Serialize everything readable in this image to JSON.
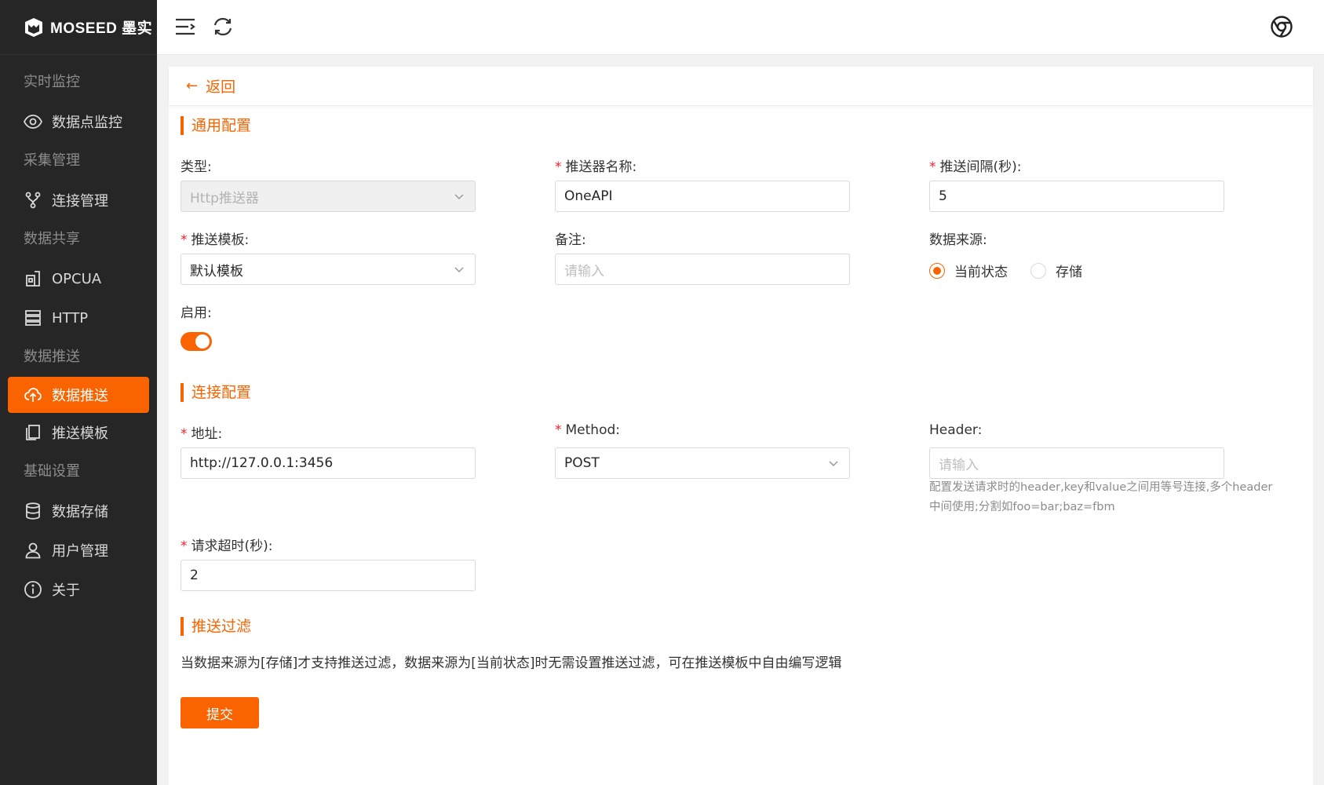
{
  "brand": {
    "name": "MOSEED 墨实"
  },
  "sidebar": {
    "groups": [
      {
        "title": "实时监控",
        "items": [
          {
            "label": "数据点监控",
            "icon": "eye-icon"
          }
        ]
      },
      {
        "title": "采集管理",
        "items": [
          {
            "label": "连接管理",
            "icon": "branch-icon"
          }
        ]
      },
      {
        "title": "数据共享",
        "items": [
          {
            "label": "OPCUA",
            "icon": "building-icon"
          },
          {
            "label": "HTTP",
            "icon": "server-icon"
          }
        ]
      },
      {
        "title": "数据推送",
        "items": [
          {
            "label": "数据推送",
            "icon": "cloud-upload-icon",
            "active": true
          },
          {
            "label": "推送模板",
            "icon": "copy-icon"
          }
        ]
      },
      {
        "title": "基础设置",
        "items": [
          {
            "label": "数据存储",
            "icon": "database-icon"
          },
          {
            "label": "用户管理",
            "icon": "user-icon"
          },
          {
            "label": "关于",
            "icon": "info-icon"
          }
        ]
      }
    ]
  },
  "topbar": {
    "icons": [
      "menu-fold-icon",
      "refresh-icon",
      "chrome-icon"
    ]
  },
  "page": {
    "back_label": "返回"
  },
  "form": {
    "section_general": "通用配置",
    "type": {
      "label": "类型:",
      "value": "Http推送器"
    },
    "name": {
      "label": "推送器名称:",
      "value": "OneAPI"
    },
    "interval": {
      "label": "推送间隔(秒):",
      "value": "5"
    },
    "template": {
      "label": "推送模板:",
      "value": "默认模板"
    },
    "remark": {
      "label": "备注:",
      "placeholder": "请输入"
    },
    "source": {
      "label": "数据来源:",
      "options": [
        "当前状态",
        "存储"
      ],
      "selected": "当前状态"
    },
    "enabled": {
      "label": "启用:",
      "value": true
    },
    "section_connection": "连接配置",
    "address": {
      "label": "地址:",
      "value": "http://127.0.0.1:3456"
    },
    "method": {
      "label": "Method:",
      "value": "POST"
    },
    "header": {
      "label": "Header:",
      "placeholder": "请输入",
      "help": "配置发送请求时的header,key和value之间用等号连接,多个header中间使用;分割如foo=bar;baz=fbm"
    },
    "timeout": {
      "label": "请求超时(秒):",
      "value": "2"
    },
    "section_filter": "推送过滤",
    "filter_note": "当数据来源为[存储]才支持推送过滤，数据来源为[当前状态]时无需设置推送过滤，可在推送模板中自由编写逻辑",
    "submit_label": "提交"
  },
  "colors": {
    "accent": "#fa6400",
    "sidebar_bg": "#262626"
  }
}
